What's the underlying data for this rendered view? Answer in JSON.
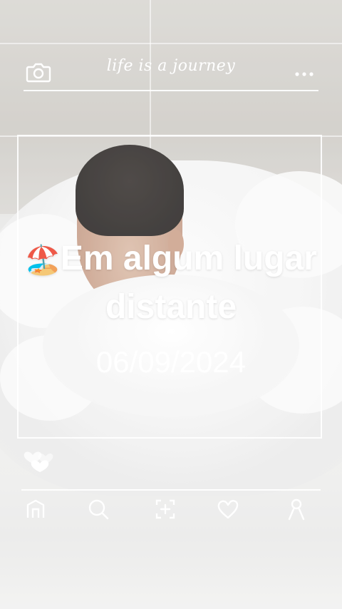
{
  "header": {
    "title": "life is a journey",
    "camera_icon": "camera-icon",
    "more_icon": "more-icon"
  },
  "post": {
    "caption_emoji": "🏖️",
    "caption_text": "Em algum lugar distante",
    "date": "06/09/2024"
  },
  "reactions": {
    "icon": "hearts-icon"
  },
  "nav": {
    "items": [
      {
        "icon": "home-icon"
      },
      {
        "icon": "search-icon"
      },
      {
        "icon": "add-post-icon"
      },
      {
        "icon": "heart-icon"
      },
      {
        "icon": "profile-icon"
      }
    ]
  },
  "colors": {
    "overlay_line": "#ffffff",
    "text": "#ffffff"
  }
}
